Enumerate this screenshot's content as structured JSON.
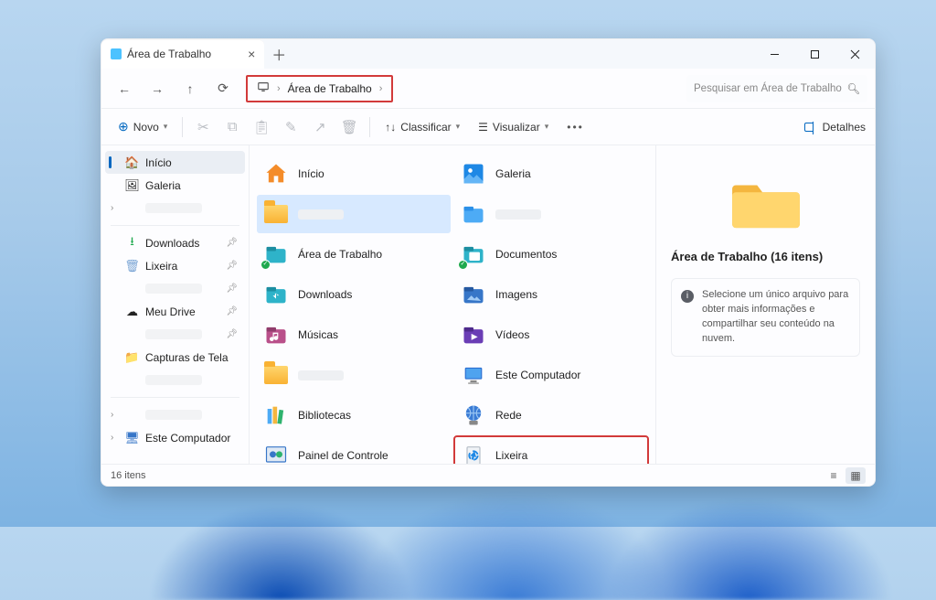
{
  "tab": {
    "title": "Área de Trabalho"
  },
  "breadcrumb": {
    "location": "Área de Trabalho"
  },
  "search": {
    "placeholder": "Pesquisar em Área de Trabalho"
  },
  "toolbar": {
    "novo": "Novo",
    "classificar": "Classificar",
    "visualizar": "Visualizar",
    "detalhes": "Detalhes"
  },
  "sidebar": {
    "inicio": "Início",
    "galeria": "Galeria",
    "downloads": "Downloads",
    "lixeira": "Lixeira",
    "meudrive": "Meu Drive",
    "capturas": "Capturas de Tela",
    "estecomputador": "Este Computador"
  },
  "files": {
    "inicio": "Início",
    "galeria": "Galeria",
    "area": "Área de Trabalho",
    "documentos": "Documentos",
    "downloads": "Downloads",
    "imagens": "Imagens",
    "musicas": "Músicas",
    "videos": "Vídeos",
    "estecomputador": "Este Computador",
    "bibliotecas": "Bibliotecas",
    "rede": "Rede",
    "painel": "Painel de Controle",
    "lixeira": "Lixeira"
  },
  "preview": {
    "title": "Área de Trabalho (16 itens)",
    "hint": "Selecione um único arquivo para obter mais informações e compartilhar seu conteúdo na nuvem."
  },
  "status": {
    "count": "16 itens"
  }
}
